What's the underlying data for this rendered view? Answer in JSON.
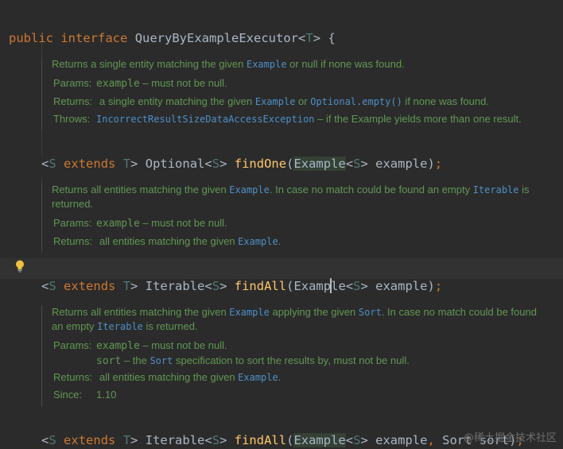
{
  "header_line": {
    "kw_public": "public",
    "kw_interface": "interface",
    "name": "QueryByExampleExecutor",
    "lt": "<",
    "type_param": "T",
    "gt": ">",
    "brace": " {"
  },
  "doc1": {
    "desc_a": "Returns a single entity matching the given ",
    "desc_code": "Example",
    "desc_b": " or null if none was found.",
    "params_label": "Params:",
    "params_code": "example",
    "params_text": " – must not be null.",
    "returns_label": "Returns:",
    "returns_a": "a single entity matching the given ",
    "returns_code1": "Example",
    "returns_b": " or ",
    "returns_code2": "Optional.empty()",
    "returns_c": " if none was found.",
    "throws_label": "Throws:",
    "throws_code": "IncorrectResultSizeDataAccessException",
    "throws_text": " – if the Example yields more than one result."
  },
  "method1": {
    "lt": "<",
    "s": "S",
    "extends": "extends",
    "t": "T",
    "gt": ">",
    "ret": "Optional",
    "ret_lt": "<",
    "ret_s": "S",
    "ret_gt": ">",
    "name": "findOne",
    "paren_open": "(",
    "param_type": "Example",
    "param_lt": "<",
    "param_s": "S",
    "param_gt": ">",
    "param_name": " example)",
    "semi": ";"
  },
  "doc2": {
    "desc_a": "Returns all entities matching the given ",
    "desc_code1": "Example",
    "desc_b": ". In case no match could be found an empty ",
    "desc_code2": "Iterable",
    "desc_c": " is returned.",
    "params_label": "Params:",
    "params_code": "example",
    "params_text": " – must not be null.",
    "returns_label": "Returns:",
    "returns_a": "all entities matching the given ",
    "returns_code": "Example",
    "returns_b": "."
  },
  "method2": {
    "lt": "<",
    "s": "S",
    "extends": "extends",
    "t": "T",
    "gt": ">",
    "ret": "Iterable",
    "ret_lt": "<",
    "ret_s": "S",
    "ret_gt": ">",
    "name": "findAll",
    "paren_open": "(",
    "param_type_a": "Examp",
    "param_type_b": "le",
    "param_lt": "<",
    "param_s": "S",
    "param_gt": ">",
    "param_name": " example)",
    "semi": ";"
  },
  "doc3": {
    "desc_a": "Returns all entities matching the given ",
    "desc_code1": "Example",
    "desc_b": " applying the given ",
    "desc_code2": "Sort",
    "desc_c": ". In case no match could be found an empty ",
    "desc_code3": "Iterable",
    "desc_d": " is returned.",
    "params_label": "Params:",
    "p1_code": "example",
    "p1_text": " – must not be null.",
    "p2_code": "sort",
    "p2_a": " – the ",
    "p2_code2": "Sort",
    "p2_b": " specification to sort the results by, must not be null.",
    "returns_label": "Returns:",
    "returns_a": "all entities matching the given ",
    "returns_code": "Example",
    "returns_b": ".",
    "since_label": "Since:",
    "since_value": "1.10"
  },
  "method3": {
    "lt": "<",
    "s": "S",
    "extends": "extends",
    "t": "T",
    "gt": ">",
    "ret": "Iterable",
    "ret_lt": "<",
    "ret_s": "S",
    "ret_gt": ">",
    "name": "findAll",
    "paren_open": "(",
    "param_type": "Example",
    "param_lt": "<",
    "param_s": "S",
    "param_gt": ">",
    "param_name": " example",
    "comma": ",",
    "param2": " Sort sort)",
    "semi": ";"
  },
  "watermark": "@稀土掘金技术社区",
  "icons": {
    "intention": "lightbulb-icon"
  },
  "colors": {
    "background": "#2b2b2b",
    "keyword": "#cc7832",
    "function": "#ffc66d",
    "doc_text": "#629755",
    "doc_link": "#4e8fc7"
  }
}
